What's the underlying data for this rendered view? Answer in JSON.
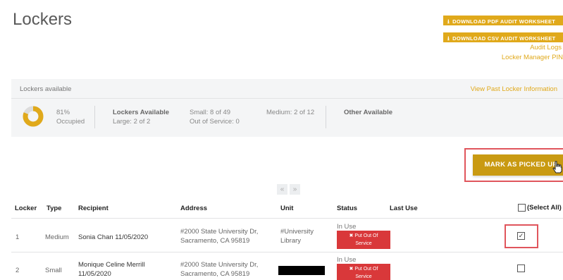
{
  "page": {
    "title": "Lockers"
  },
  "actions": {
    "download_pdf": "DOWNLOAD PDF AUDIT WORKSHEET",
    "download_csv": "DOWNLOAD CSV AUDIT WORKSHEET",
    "audit_logs": "Audit Logs",
    "locker_manager_pin": "Locker Manager PIN",
    "download_icon": "download-icon"
  },
  "availability": {
    "title": "Lockers available",
    "past_link": "View Past Locker Information",
    "occupied_pct": 81,
    "occupied_pct_label": "81%",
    "occupied_label": "Occupied",
    "lockers_available_heading": "Lockers Available",
    "large": "Large: 2 of 2",
    "small": "Small: 8 of 49",
    "out_of_service": "Out of Service: 0",
    "medium": "Medium: 2 of 12",
    "other_available_heading": "Other Available"
  },
  "toolbar": {
    "mark_picked_up": "MARK AS PICKED UP",
    "pager_prev": "«",
    "pager_next": "»"
  },
  "table": {
    "headers": [
      "Locker",
      "Type",
      "Recipient",
      "Address",
      "Unit",
      "Status",
      "Last Use"
    ],
    "select_all": "(Select All)",
    "rows": [
      {
        "locker": "1",
        "type": "Medium",
        "recipient": "Sonia Chan 11/05/2020",
        "address_1": "#2000 State University Dr,",
        "address_2": "Sacramento, CA 95819",
        "unit_1": "#University",
        "unit_2": "Library",
        "status": "In Use",
        "oos_1": "✖ Put Out Of",
        "oos_2": "Service",
        "checked": true
      },
      {
        "locker": "2",
        "type": "Small",
        "recipient_1": "Monique Celine Merrill",
        "recipient_2": "11/05/2020",
        "address_1": "#2000 State University Dr,",
        "address_2": "Sacramento, CA 95819",
        "unit_redacted": true,
        "status": "In Use",
        "oos_1": "✖ Put Out Of",
        "oos_2": "Service",
        "checked": false
      }
    ]
  },
  "colors": {
    "accent": "#e0a91b",
    "primary_button": "#c99a12",
    "danger": "#d9383a",
    "highlight": "#e0555c"
  }
}
